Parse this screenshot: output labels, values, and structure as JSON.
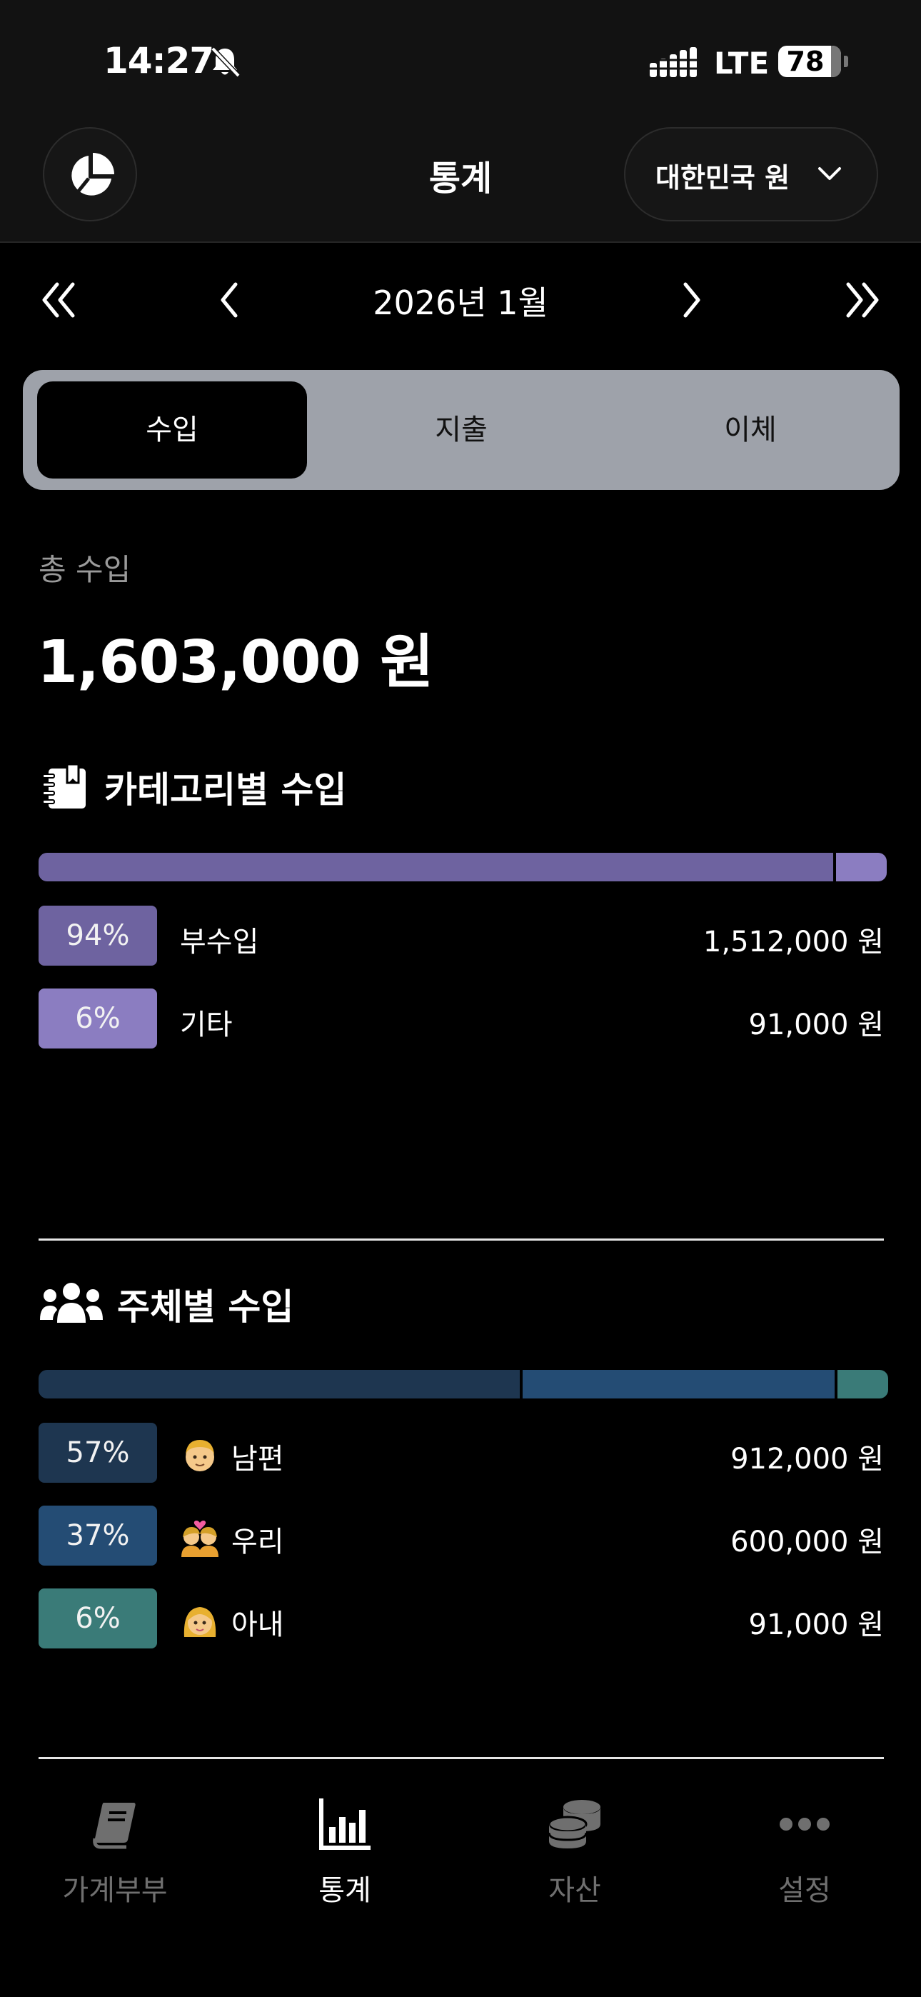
{
  "status_bar": {
    "time": "14:27",
    "network": "LTE",
    "battery": "78"
  },
  "header": {
    "title": "통계",
    "currency_label": "대한민국 원"
  },
  "month_nav": {
    "label": "2026년 1월"
  },
  "type_tabs": [
    {
      "label": "수입",
      "active": true
    },
    {
      "label": "지출",
      "active": false
    },
    {
      "label": "이체",
      "active": false
    }
  ],
  "summary": {
    "label": "총 수입",
    "value": "1,603,000 원"
  },
  "category_section": {
    "title": "카테고리별 수입",
    "icon": "notebook-icon",
    "items": [
      {
        "percent": "94%",
        "name": "부수입",
        "amount": "1,512,000 원",
        "share": 0.94,
        "color": "#6e63a0"
      },
      {
        "percent": "6%",
        "name": "기타",
        "amount": "91,000 원",
        "share": 0.06,
        "color": "#8b7dc1"
      }
    ]
  },
  "person_section": {
    "title": "주체별 수입",
    "icon": "users-icon",
    "items": [
      {
        "percent": "57%",
        "name": "남편",
        "emoji": "man-emoji",
        "amount": "912,000 원",
        "share": 0.57,
        "color": "#1e3650"
      },
      {
        "percent": "37%",
        "name": "우리",
        "emoji": "couple-emoji",
        "amount": "600,000 원",
        "share": 0.37,
        "color": "#244c74"
      },
      {
        "percent": "6%",
        "name": "아내",
        "emoji": "woman-emoji",
        "amount": "91,000 원",
        "share": 0.06,
        "color": "#3a7b78"
      }
    ]
  },
  "tab_bar": [
    {
      "label": "가계부부",
      "icon": "book-icon",
      "active": false
    },
    {
      "label": "통계",
      "icon": "bar-chart-icon",
      "active": true
    },
    {
      "label": "자산",
      "icon": "coins-icon",
      "active": false
    },
    {
      "label": "설정",
      "icon": "more-icon",
      "active": false
    }
  ]
}
